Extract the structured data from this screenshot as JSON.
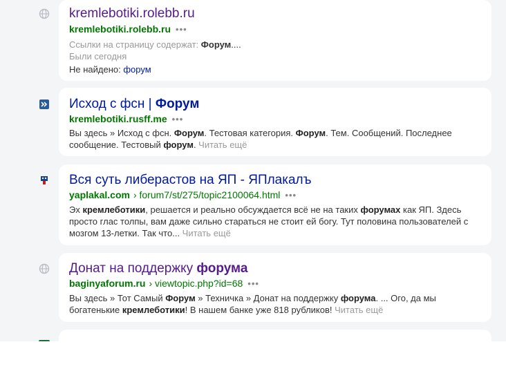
{
  "results": [
    {
      "title_pre": "kremlebotiki.rolebb.ru",
      "host": "kremlebotiki.rolebb.ru",
      "meta1_pre": "Ссылки на страницу содержат: ",
      "meta1_bold": "Форум",
      "meta1_post": "....",
      "meta2": "Были сегодня",
      "notfound_label": "Не найдено: ",
      "notfound_word": "форум",
      "favicon": "globe-icon"
    },
    {
      "title_pre": "Исход с фсн | ",
      "title_bold": "Форум",
      "host": "kremlebotiki.rusff.me",
      "snippet": [
        "Вы здесь » Исход с фсн. ",
        "Форум",
        ". Тестовая категория. ",
        "Форум",
        ". Тем. Сообщений. Последнее сообщение. Тестовый ",
        "форум",
        ". "
      ],
      "more": "Читать ещё",
      "favicon": "rusff-icon"
    },
    {
      "title_pre": "Вся суть либерастов на ЯП - ЯПлакалъ",
      "host": "yaplakal.com",
      "path": "› forum7/st/275/topic2100064.html",
      "snippet": [
        "Эх ",
        "кремлеботики",
        ", решается и реально обсуждается всё не на таких ",
        "форумах",
        " как ЯП. Здесь просто глас толпы, вам даже сильно стараться не стоит ей богу. Тут половина пользователей с мозгом 13-летки. Так что... "
      ],
      "more": "Читать ещё",
      "favicon": "yaplakal-icon"
    },
    {
      "title_pre": "Донат на поддержку ",
      "title_bold": "форума",
      "host": "baginyaforum.ru",
      "path": "› viewtopic.php?id=68",
      "snippet": [
        "Вы здесь » Тот Самый ",
        "Форум",
        " » Техничка » Донат на поддержку ",
        "форума",
        ". ... Ого, да мы богатенькие ",
        "кремлеботики",
        "! В нашем банке уже 818 рубликов! "
      ],
      "more": "Читать ещё",
      "favicon": "globe-icon"
    }
  ],
  "colors": {
    "visited": "#551a8b",
    "link": "#001a9c",
    "url": "#007700",
    "page_bg": "#f4f5f7"
  }
}
